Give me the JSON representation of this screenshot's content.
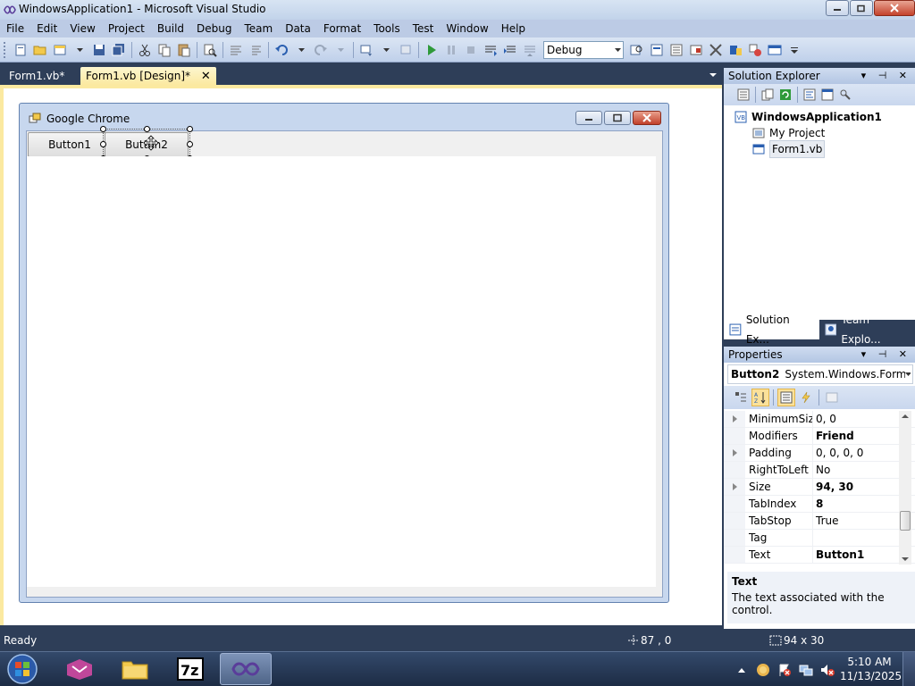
{
  "window": {
    "title": "WindowsApplication1 - Microsoft Visual Studio"
  },
  "menu": [
    "File",
    "Edit",
    "View",
    "Project",
    "Build",
    "Debug",
    "Team",
    "Data",
    "Format",
    "Tools",
    "Test",
    "Window",
    "Help"
  ],
  "toolbar": {
    "configuration": "Debug"
  },
  "document_tabs": [
    {
      "label": "Form1.vb*",
      "active": false
    },
    {
      "label": "Form1.vb [Design]*",
      "active": true
    }
  ],
  "designer_form": {
    "title": "Google Chrome",
    "buttons": [
      {
        "label": "Button1"
      },
      {
        "label": "Button2"
      }
    ]
  },
  "solution_explorer": {
    "title": "Solution Explorer",
    "solution": "WindowsApplication1",
    "items": [
      "My Project",
      "Form1.vb"
    ],
    "tabs": [
      "Solution Ex...",
      "Team Explo..."
    ]
  },
  "properties": {
    "title": "Properties",
    "object_name": "Button2",
    "object_type": "System.Windows.Forms.E",
    "rows": [
      {
        "name": "MinimumSize",
        "value": "0, 0",
        "expandable": true,
        "bold": false
      },
      {
        "name": "Modifiers",
        "value": "Friend",
        "expandable": false,
        "bold": true
      },
      {
        "name": "Padding",
        "value": "0, 0, 0, 0",
        "expandable": true,
        "bold": false
      },
      {
        "name": "RightToLeft",
        "value": "No",
        "expandable": false,
        "bold": false
      },
      {
        "name": "Size",
        "value": "94, 30",
        "expandable": true,
        "bold": true
      },
      {
        "name": "TabIndex",
        "value": "8",
        "expandable": false,
        "bold": true
      },
      {
        "name": "TabStop",
        "value": "True",
        "expandable": false,
        "bold": false
      },
      {
        "name": "Tag",
        "value": "",
        "expandable": false,
        "bold": false
      },
      {
        "name": "Text",
        "value": "Button1",
        "expandable": false,
        "bold": true
      }
    ],
    "description_title": "Text",
    "description_text": "The text associated with the control."
  },
  "statusbar": {
    "text": "Ready",
    "position": "87 , 0",
    "size": "94 x 30"
  },
  "taskbar": {
    "time": "5:10 AM",
    "date": "11/13/2025"
  },
  "colors": {
    "ide_background": "#2e3e58",
    "active_tab": "#fbe9a0",
    "menu_bar": "#bccbe5"
  }
}
